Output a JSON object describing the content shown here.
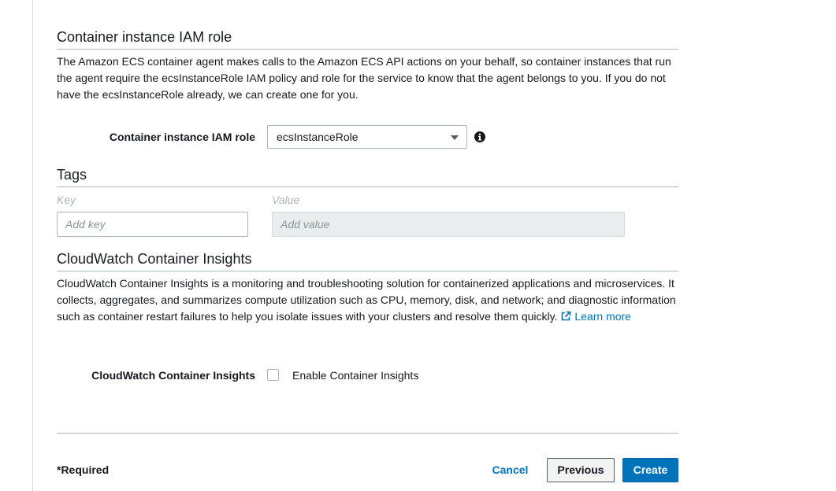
{
  "iam_section": {
    "title": "Container instance IAM role",
    "description": "The Amazon ECS container agent makes calls to the Amazon ECS API actions on your behalf, so container instances that run the agent require the ecsInstanceRole IAM policy and role for the service to know that the agent belongs to you. If you do not have the ecsInstanceRole already, we can create one for you.",
    "field_label": "Container instance IAM role",
    "selected_role": "ecsInstanceRole",
    "info_icon": "info-icon"
  },
  "tags_section": {
    "title": "Tags",
    "key_label": "Key",
    "value_label": "Value",
    "key_placeholder": "Add key",
    "value_placeholder": "Add value"
  },
  "insights_section": {
    "title": "CloudWatch Container Insights",
    "description": "CloudWatch Container Insights is a monitoring and troubleshooting solution for containerized applications and microservices. It collects, aggregates, and summarizes compute utilization such as CPU, memory, disk, and network; and diagnostic information such as container restart failures to help you isolate issues with your clusters and resolve them quickly.",
    "learn_more": "Learn more",
    "learn_more_icon": "external-link-icon",
    "field_label": "CloudWatch Container Insights",
    "checkbox_label": "Enable Container Insights",
    "checked": false
  },
  "footer": {
    "required_note": "*Required",
    "cancel_label": "Cancel",
    "previous_label": "Previous",
    "create_label": "Create"
  },
  "colors": {
    "link": "#0073bb",
    "primary_button": "#0073bb",
    "divider": "#aab7b8"
  }
}
